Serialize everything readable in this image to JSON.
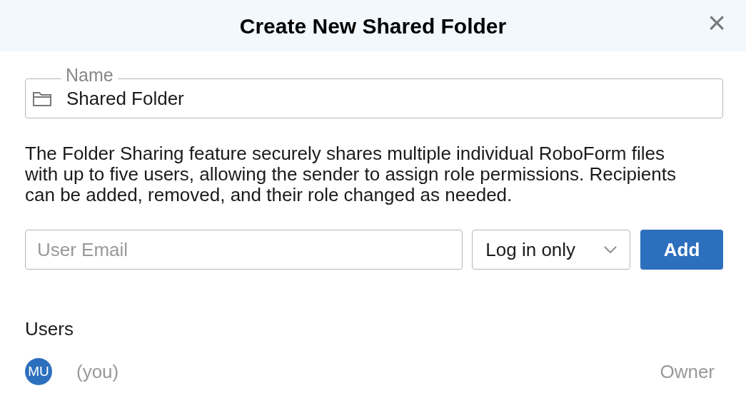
{
  "dialog": {
    "title": "Create New Shared Folder",
    "close": "×"
  },
  "name_field": {
    "label": "Name",
    "value": "Shared Folder"
  },
  "description": "The Folder Sharing feature securely shares multiple individual RoboForm files with up to five users, allowing the sender to assign role permissions. Recipients can be added, removed, and their role changed as needed.",
  "email_field": {
    "placeholder": "User Email"
  },
  "role_select": {
    "value": "Log in only"
  },
  "add_button": "Add",
  "users": {
    "heading": "Users",
    "rows": [
      {
        "initials": "MU",
        "name": "(you)",
        "role": "Owner"
      }
    ]
  }
}
